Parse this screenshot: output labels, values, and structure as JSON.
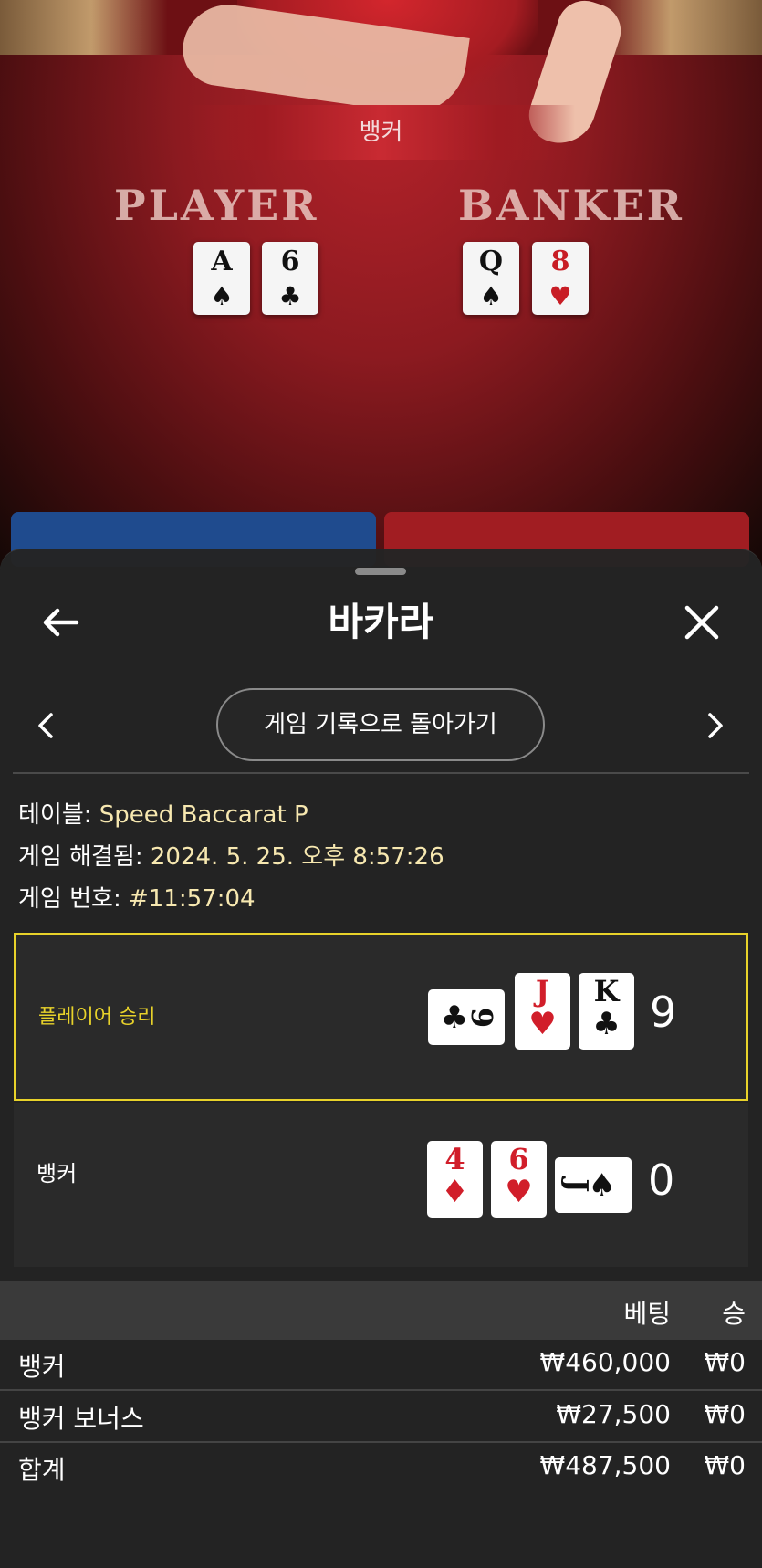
{
  "table": {
    "result_banner": "뱅커",
    "player_label": "PLAYER",
    "banker_label": "BANKER",
    "player_cards": [
      {
        "rank": "A",
        "suit": "♠",
        "color": "black"
      },
      {
        "rank": "6",
        "suit": "♣",
        "color": "black"
      }
    ],
    "banker_cards": [
      {
        "rank": "Q",
        "suit": "♠",
        "color": "black"
      },
      {
        "rank": "8",
        "suit": "♥",
        "color": "red"
      }
    ]
  },
  "sheet": {
    "title": "바카라",
    "back_icon": "arrow-left-icon",
    "close_icon": "close-icon",
    "history_button": "게임 기록으로 돌아가기",
    "info": {
      "table_label": "테이블:",
      "table_value": "Speed Baccarat P",
      "resolved_label": "게임 해결됨:",
      "resolved_value": "2024. 5. 25. 오후 8:57:26",
      "round_label": "게임 번호:",
      "round_value": "#11:57:04"
    },
    "player_result": {
      "label": "플레이어 승리",
      "score": "9",
      "cards": [
        {
          "rank": "9",
          "suit": "♣",
          "color": "black",
          "rotated": true
        },
        {
          "rank": "J",
          "suit": "♥",
          "color": "red",
          "rotated": false
        },
        {
          "rank": "K",
          "suit": "♣",
          "color": "black",
          "rotated": false
        }
      ]
    },
    "banker_result": {
      "label": "뱅커",
      "score": "0",
      "cards": [
        {
          "rank": "4",
          "suit": "♦",
          "color": "red",
          "rotated": false
        },
        {
          "rank": "6",
          "suit": "♥",
          "color": "red",
          "rotated": false
        },
        {
          "rank": "J",
          "suit": "♠",
          "color": "black",
          "rotated": true
        }
      ]
    },
    "bets": {
      "headers": {
        "bet": "베팅",
        "win": "승"
      },
      "rows": [
        {
          "name": "뱅커",
          "amount": "₩460,000",
          "win": "₩0"
        },
        {
          "name": "뱅커 보너스",
          "amount": "₩27,500",
          "win": "₩0"
        },
        {
          "name": "합계",
          "amount": "₩487,500",
          "win": "₩0"
        }
      ]
    }
  },
  "colors": {
    "accent_yellow": "#e8d22a",
    "value_cream": "#f7e8b0",
    "table_red": "#a11d22",
    "player_blue": "#1f4b8e"
  }
}
